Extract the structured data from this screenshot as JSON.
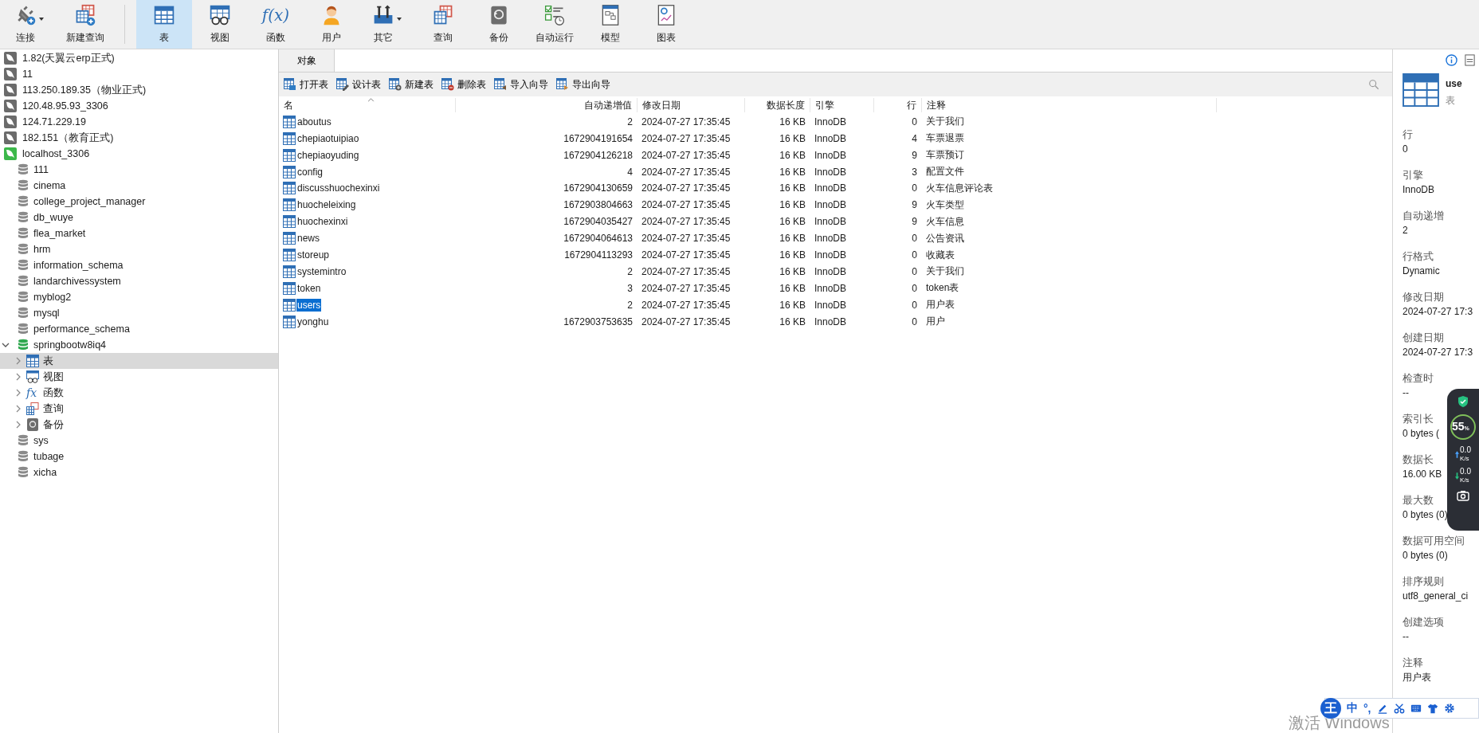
{
  "toolbar": [
    {
      "label": "连接",
      "kind": "connect",
      "selected": false,
      "dropdown": true
    },
    {
      "label": "新建查询",
      "kind": "new-query",
      "selected": false,
      "dropdown": false
    },
    {
      "label": "表",
      "kind": "table",
      "selected": true,
      "dropdown": false
    },
    {
      "label": "视图",
      "kind": "view",
      "selected": false,
      "dropdown": false
    },
    {
      "label": "函数",
      "kind": "function",
      "glyph": "f(x)",
      "selected": false,
      "dropdown": false
    },
    {
      "label": "用户",
      "kind": "user",
      "selected": false,
      "dropdown": false
    },
    {
      "label": "其它",
      "kind": "other",
      "selected": false,
      "dropdown": true
    },
    {
      "label": "查询",
      "kind": "query",
      "selected": false,
      "dropdown": false
    },
    {
      "label": "备份",
      "kind": "backup",
      "selected": false,
      "dropdown": false
    },
    {
      "label": "自动运行",
      "kind": "automation",
      "selected": false,
      "dropdown": false
    },
    {
      "label": "模型",
      "kind": "model",
      "selected": false,
      "dropdown": false
    },
    {
      "label": "图表",
      "kind": "chart",
      "selected": false,
      "dropdown": false
    }
  ],
  "sidebar": {
    "connections": [
      {
        "name": "1.82(天翼云erp正式)",
        "connected": false
      },
      {
        "name": "11",
        "connected": false
      },
      {
        "name": "113.250.189.35（物业正式)",
        "connected": false
      },
      {
        "name": "120.48.95.93_3306",
        "connected": false
      },
      {
        "name": "124.71.229.19",
        "connected": false
      },
      {
        "name": "182.151（教育正式)",
        "connected": false
      },
      {
        "name": "localhost_3306",
        "connected": true,
        "children": [
          {
            "name": "111",
            "open": false
          },
          {
            "name": "cinema",
            "open": false
          },
          {
            "name": "college_project_manager",
            "open": false
          },
          {
            "name": "db_wuye",
            "open": false
          },
          {
            "name": "flea_market",
            "open": false
          },
          {
            "name": "hrm",
            "open": false
          },
          {
            "name": "information_schema",
            "open": false
          },
          {
            "name": "landarchivessystem",
            "open": false
          },
          {
            "name": "myblog2",
            "open": false
          },
          {
            "name": "mysql",
            "open": false
          },
          {
            "name": "performance_schema",
            "open": false
          },
          {
            "name": "springbootw8iq4",
            "open": true,
            "children": [
              {
                "label": "表",
                "kind": "table",
                "selected": true,
                "expanded": false
              },
              {
                "label": "视图",
                "kind": "view",
                "selected": false,
                "expanded": false
              },
              {
                "label": "函数",
                "kind": "function",
                "glyph": "fx",
                "selected": false,
                "expanded": false
              },
              {
                "label": "查询",
                "kind": "query",
                "selected": false,
                "expanded": false
              },
              {
                "label": "备份",
                "kind": "backup",
                "selected": false,
                "expanded": false
              }
            ]
          },
          {
            "name": "sys",
            "open": false
          },
          {
            "name": "tubage",
            "open": false
          },
          {
            "name": "xicha",
            "open": false
          }
        ]
      }
    ]
  },
  "tabs": [
    {
      "label": "对象",
      "selected": true
    }
  ],
  "actions": [
    {
      "label": "打开表",
      "kind": "open"
    },
    {
      "label": "设计表",
      "kind": "design"
    },
    {
      "label": "新建表",
      "kind": "new"
    },
    {
      "label": "删除表",
      "kind": "delete"
    },
    {
      "label": "导入向导",
      "kind": "import"
    },
    {
      "label": "导出向导",
      "kind": "export"
    }
  ],
  "table": {
    "columns": [
      {
        "label": "名",
        "sorted": true
      },
      {
        "label": "自动递增值",
        "sorted": false
      },
      {
        "label": "修改日期",
        "sorted": false
      },
      {
        "label": "数据长度",
        "sorted": false
      },
      {
        "label": "引擎",
        "sorted": false
      },
      {
        "label": "行",
        "sorted": false
      },
      {
        "label": "注释",
        "sorted": false
      }
    ],
    "rows": [
      {
        "selected": false,
        "cells": [
          "aboutus",
          "2",
          "2024-07-27 17:35:45",
          "16 KB",
          "InnoDB",
          "0",
          "关于我们"
        ]
      },
      {
        "selected": false,
        "cells": [
          "chepiaotuipiao",
          "1672904191654",
          "2024-07-27 17:35:45",
          "16 KB",
          "InnoDB",
          "4",
          "车票退票"
        ]
      },
      {
        "selected": false,
        "cells": [
          "chepiaoyuding",
          "1672904126218",
          "2024-07-27 17:35:45",
          "16 KB",
          "InnoDB",
          "9",
          "车票预订"
        ]
      },
      {
        "selected": false,
        "cells": [
          "config",
          "4",
          "2024-07-27 17:35:45",
          "16 KB",
          "InnoDB",
          "3",
          "配置文件"
        ]
      },
      {
        "selected": false,
        "cells": [
          "discusshuochexinxi",
          "1672904130659",
          "2024-07-27 17:35:45",
          "16 KB",
          "InnoDB",
          "0",
          "火车信息评论表"
        ]
      },
      {
        "selected": false,
        "cells": [
          "huocheleixing",
          "1672903804663",
          "2024-07-27 17:35:45",
          "16 KB",
          "InnoDB",
          "9",
          "火车类型"
        ]
      },
      {
        "selected": false,
        "cells": [
          "huochexinxi",
          "1672904035427",
          "2024-07-27 17:35:45",
          "16 KB",
          "InnoDB",
          "9",
          "火车信息"
        ]
      },
      {
        "selected": false,
        "cells": [
          "news",
          "1672904064613",
          "2024-07-27 17:35:45",
          "16 KB",
          "InnoDB",
          "0",
          "公告资讯"
        ]
      },
      {
        "selected": false,
        "cells": [
          "storeup",
          "1672904113293",
          "2024-07-27 17:35:45",
          "16 KB",
          "InnoDB",
          "0",
          "收藏表"
        ]
      },
      {
        "selected": false,
        "cells": [
          "systemintro",
          "2",
          "2024-07-27 17:35:45",
          "16 KB",
          "InnoDB",
          "0",
          "关于我们"
        ]
      },
      {
        "selected": false,
        "cells": [
          "token",
          "3",
          "2024-07-27 17:35:45",
          "16 KB",
          "InnoDB",
          "0",
          "token表"
        ]
      },
      {
        "selected": true,
        "cells": [
          "users",
          "2",
          "2024-07-27 17:35:45",
          "16 KB",
          "InnoDB",
          "0",
          "用户表"
        ]
      },
      {
        "selected": false,
        "cells": [
          "yonghu",
          "1672903753635",
          "2024-07-27 17:35:45",
          "16 KB",
          "InnoDB",
          "0",
          "用户"
        ]
      }
    ]
  },
  "details": {
    "name": "use",
    "type": "表",
    "properties": [
      {
        "label": "行",
        "value": "0"
      },
      {
        "label": "引擎",
        "value": "InnoDB"
      },
      {
        "label": "自动递增",
        "value": "2"
      },
      {
        "label": "行格式",
        "value": "Dynamic"
      },
      {
        "label": "修改日期",
        "value": "2024-07-27 17:3"
      },
      {
        "label": "创建日期",
        "value": "2024-07-27 17:3"
      },
      {
        "label": "检查时",
        "value": "--"
      },
      {
        "label": "索引长",
        "value": "0 bytes ("
      },
      {
        "label": "数据长",
        "value": "16.00 KB"
      },
      {
        "label": "最大数",
        "value": "0 bytes (0)"
      },
      {
        "label": "数据可用空间",
        "value": "0 bytes (0)"
      },
      {
        "label": "排序规则",
        "value": "utf8_general_ci"
      },
      {
        "label": "创建选项",
        "value": "--"
      },
      {
        "label": "注释",
        "value": "用户表"
      }
    ]
  },
  "monitor": {
    "percent": "55",
    "unit": "%",
    "upload": {
      "value": "0.0",
      "unit": "K/s"
    },
    "download": {
      "value": "0.0",
      "unit": "K/s"
    }
  },
  "ime": {
    "logo": "王",
    "mode": "中",
    "punctuation": "°,"
  },
  "activation_notice": "激活 Windows"
}
